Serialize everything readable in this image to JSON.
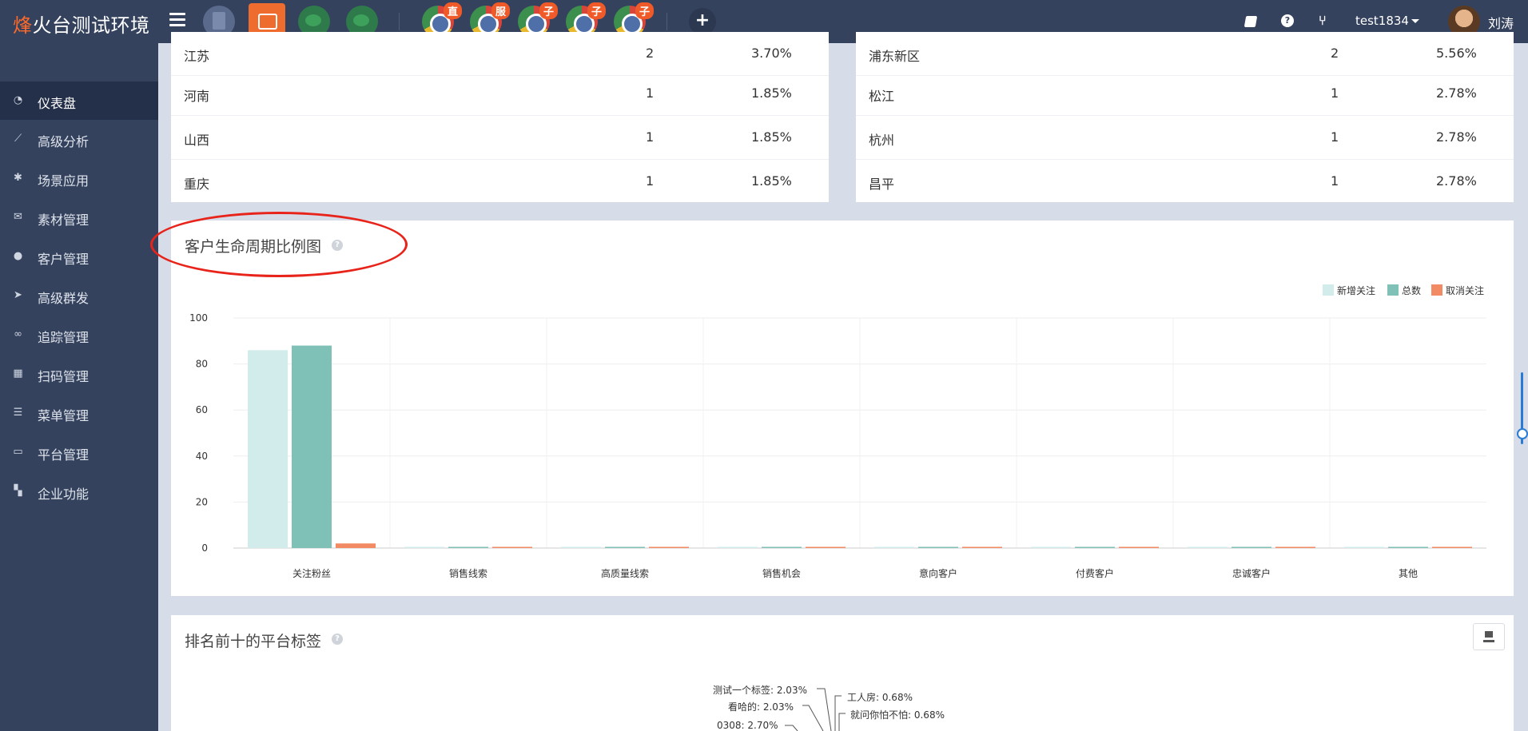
{
  "app": {
    "brand_accent": "烽",
    "brand_rest": "火台测试环境",
    "user": "test1834",
    "nickname": "刘涛"
  },
  "accounts": [
    {
      "type": "gray",
      "badge": ""
    },
    {
      "type": "orange",
      "badge": ""
    },
    {
      "type": "wechat",
      "badge": ""
    },
    {
      "type": "wechat",
      "badge": ""
    },
    {
      "type": "chrome",
      "badge": "直"
    },
    {
      "type": "chrome",
      "badge": "服"
    },
    {
      "type": "chrome",
      "badge": "子"
    },
    {
      "type": "chrome",
      "badge": "子"
    },
    {
      "type": "chrome",
      "badge": "子"
    }
  ],
  "sidebar": {
    "items": [
      {
        "label": "仪表盘",
        "icon": "dashboard-icon",
        "active": true
      },
      {
        "label": "高级分析",
        "icon": "line-chart-icon"
      },
      {
        "label": "场景应用",
        "icon": "gear-icon"
      },
      {
        "label": "素材管理",
        "icon": "envelope-icon"
      },
      {
        "label": "客户管理",
        "icon": "user-icon"
      },
      {
        "label": "高级群发",
        "icon": "paper-plane-icon"
      },
      {
        "label": "追踪管理",
        "icon": "link-icon"
      },
      {
        "label": "扫码管理",
        "icon": "qrcode-icon"
      },
      {
        "label": "菜单管理",
        "icon": "list-icon"
      },
      {
        "label": "平台管理",
        "icon": "desktop-icon"
      },
      {
        "label": "企业功能",
        "icon": "grid-icon"
      }
    ]
  },
  "province_table": {
    "rows": [
      {
        "name": "江苏",
        "count": "2",
        "pct": "3.70%"
      },
      {
        "name": "河南",
        "count": "1",
        "pct": "1.85%"
      },
      {
        "name": "山西",
        "count": "1",
        "pct": "1.85%"
      },
      {
        "name": "重庆",
        "count": "1",
        "pct": "1.85%"
      }
    ]
  },
  "city_table": {
    "rows": [
      {
        "name": "浦东新区",
        "count": "2",
        "pct": "5.56%"
      },
      {
        "name": "松江",
        "count": "1",
        "pct": "2.78%"
      },
      {
        "name": "杭州",
        "count": "1",
        "pct": "2.78%"
      },
      {
        "name": "昌平",
        "count": "1",
        "pct": "2.78%"
      }
    ]
  },
  "lifecycle": {
    "title": "客户生命周期比例图",
    "help": "?"
  },
  "chart_data": {
    "type": "bar",
    "categories": [
      "关注粉丝",
      "销售线索",
      "高质量线索",
      "销售机会",
      "意向客户",
      "付费客户",
      "忠诚客户",
      "其他"
    ],
    "series": [
      {
        "name": "新增关注",
        "color": "#d2ecec",
        "values": [
          86,
          0,
          0,
          0,
          0,
          0,
          0,
          0
        ]
      },
      {
        "name": "总数",
        "color": "#7fc1b6",
        "values": [
          88,
          0,
          0,
          0,
          0,
          0,
          0,
          0
        ]
      },
      {
        "name": "取消关注",
        "color": "#f28a64",
        "values": [
          2,
          0,
          0,
          0,
          0,
          0,
          0,
          0
        ]
      }
    ],
    "yticks": [
      "0",
      "20",
      "40",
      "60",
      "80",
      "100"
    ],
    "ylim": [
      0,
      100
    ],
    "legend": "top-right",
    "grid": true
  },
  "top_tags": {
    "title": "排名前十的平台标签",
    "help": "?",
    "labels": [
      "测试一个标签: 2.03%",
      "看哈的: 2.03%",
      "0308: 2.70%",
      "工人房: 0.68%",
      "就问你怕不怕: 0.68%"
    ]
  }
}
